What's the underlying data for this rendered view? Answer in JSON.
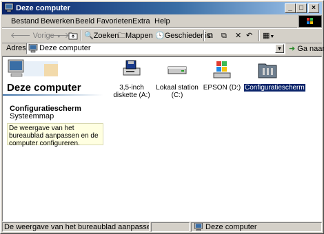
{
  "window": {
    "title": "Deze computer"
  },
  "menubar": [
    "Bestand",
    "Bewerken",
    "Beeld",
    "Favorieten",
    "Extra",
    "Help"
  ],
  "toolbar": {
    "back": "Vorige",
    "search": "Zoeken",
    "folders": "Mappen",
    "history": "Geschiedenis"
  },
  "address": {
    "label": "Adres",
    "value": "Deze computer",
    "go": "Ga naar"
  },
  "left_pane": {
    "title": "Deze computer",
    "item_title": "Configuratiescherm",
    "item_subtitle": "Systeemmap",
    "info": "De weergave van het bureaublad aanpassen en de computer configureren."
  },
  "items": [
    {
      "label": "3,5-inch diskette (A:)",
      "icon": "floppy-drive-icon"
    },
    {
      "label": "Lokaal station (C:)",
      "icon": "hard-drive-icon"
    },
    {
      "label": "EPSON (D:)",
      "icon": "cd-drive-icon"
    },
    {
      "label": "Configuratiescherm",
      "icon": "control-panel-icon",
      "selected": true
    }
  ],
  "status": {
    "text": "De weergave van het bureaublad aanpassen en de comp",
    "location": "Deze computer"
  },
  "colors": {
    "title_start": "#0a246a",
    "title_end": "#a6caf0",
    "selection": "#0a246a",
    "face": "#d4d0c8",
    "info_bg": "#ffffe1"
  }
}
